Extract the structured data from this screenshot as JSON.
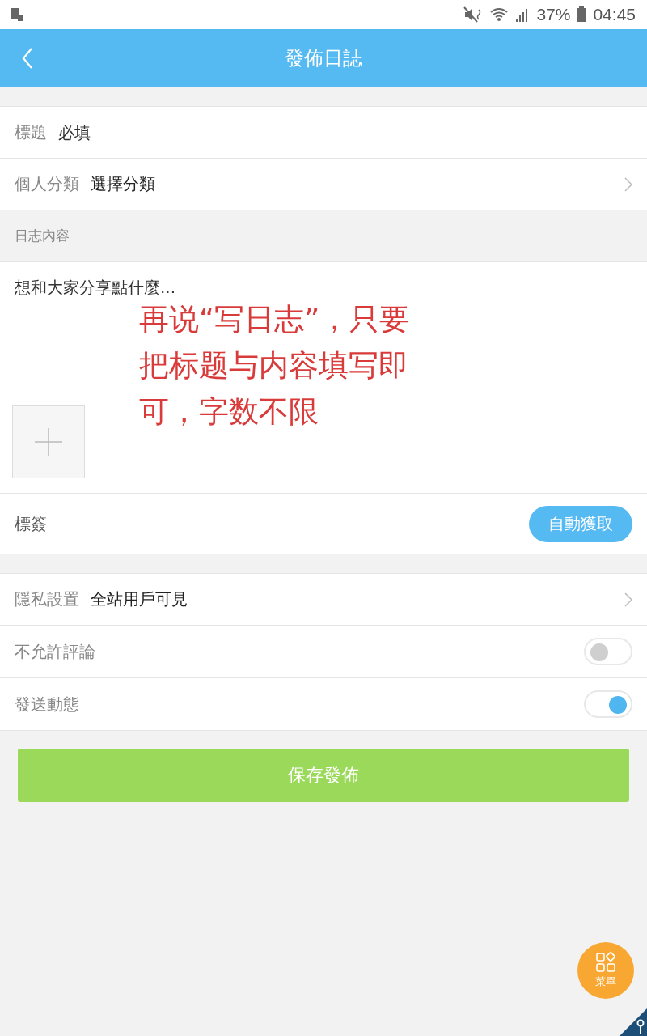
{
  "status_bar": {
    "battery": "37%",
    "time": "04:45"
  },
  "header": {
    "title": "發佈日誌"
  },
  "form": {
    "title_field": {
      "label": "標題",
      "placeholder": "必填"
    },
    "category": {
      "label": "個人分類",
      "value": "選擇分類"
    },
    "content_label": "日志內容",
    "content_field": {
      "placeholder": "想和大家分享點什麼..."
    },
    "tags": {
      "label": "標簽",
      "button": "自動獲取"
    },
    "privacy": {
      "label": "隱私設置",
      "value": "全站用戶可見"
    },
    "toggles": [
      {
        "label": "不允許評論",
        "on": false
      },
      {
        "label": "發送動態",
        "on": true
      }
    ],
    "submit": "保存發佈"
  },
  "annotation": "再说“写日志”，只要把标题与内容填写即可，字数不限",
  "fab": {
    "label": "菜單"
  }
}
